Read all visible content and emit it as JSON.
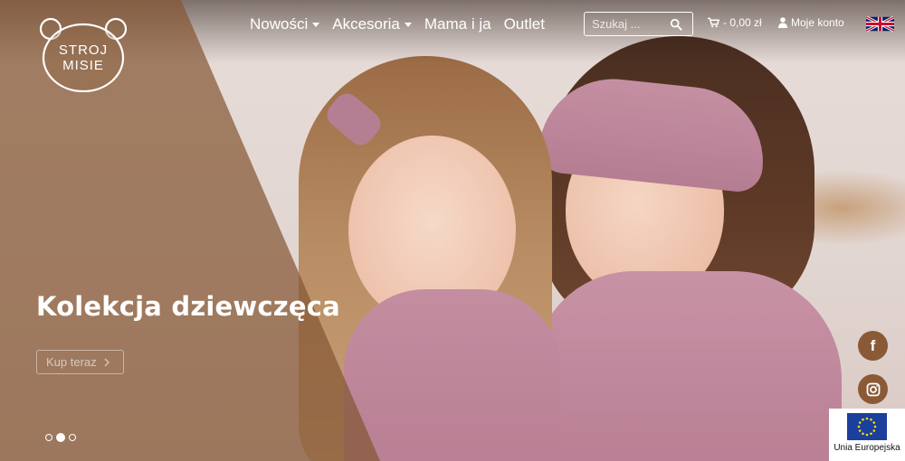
{
  "header": {
    "logo": {
      "line1": "STROJ",
      "line2": "MISIE",
      "icon": "bear-logo-icon"
    },
    "nav": [
      {
        "label": "Nowości",
        "has_dropdown": true
      },
      {
        "label": "Akcesoria",
        "has_dropdown": true
      },
      {
        "label": "Mama i ja",
        "has_dropdown": false
      },
      {
        "label": "Outlet",
        "has_dropdown": false
      }
    ],
    "search": {
      "placeholder": "Szukaj ...",
      "value": "",
      "icon": "search-icon"
    },
    "cart": {
      "label": "- 0,00 zł",
      "icon": "cart-icon"
    },
    "account": {
      "label": "Moje konto",
      "icon": "user-icon"
    },
    "language": {
      "icon": "uk-flag-icon"
    }
  },
  "hero": {
    "title": "Kolekcja dziewczęca",
    "cta_label": "Kup teraz",
    "cta_icon": "chevron-right-icon",
    "slides_total": 3,
    "active_slide": 2
  },
  "social": [
    {
      "name": "facebook",
      "icon": "facebook-icon",
      "glyph": "f"
    },
    {
      "name": "instagram",
      "icon": "instagram-icon"
    }
  ],
  "eu_badge": {
    "label": "Unia Europejska",
    "icon": "eu-flag-icon"
  },
  "colors": {
    "overlay_brown": "#855834",
    "social_bg": "#8a5a37",
    "text_white": "#ffffff",
    "eu_blue": "#1b3f9c",
    "eu_star": "#ffdd00"
  }
}
